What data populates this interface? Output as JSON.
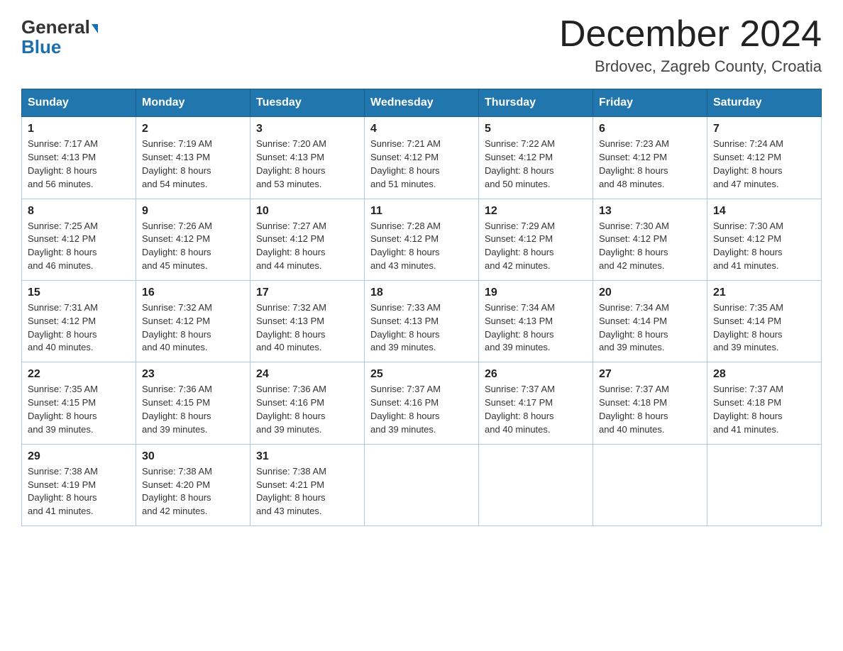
{
  "header": {
    "logo_general": "General",
    "logo_blue": "Blue",
    "month_title": "December 2024",
    "location": "Brdovec, Zagreb County, Croatia"
  },
  "weekdays": [
    "Sunday",
    "Monday",
    "Tuesday",
    "Wednesday",
    "Thursday",
    "Friday",
    "Saturday"
  ],
  "weeks": [
    [
      {
        "day": "1",
        "sunrise": "7:17 AM",
        "sunset": "4:13 PM",
        "daylight": "8 hours and 56 minutes."
      },
      {
        "day": "2",
        "sunrise": "7:19 AM",
        "sunset": "4:13 PM",
        "daylight": "8 hours and 54 minutes."
      },
      {
        "day": "3",
        "sunrise": "7:20 AM",
        "sunset": "4:13 PM",
        "daylight": "8 hours and 53 minutes."
      },
      {
        "day": "4",
        "sunrise": "7:21 AM",
        "sunset": "4:12 PM",
        "daylight": "8 hours and 51 minutes."
      },
      {
        "day": "5",
        "sunrise": "7:22 AM",
        "sunset": "4:12 PM",
        "daylight": "8 hours and 50 minutes."
      },
      {
        "day": "6",
        "sunrise": "7:23 AM",
        "sunset": "4:12 PM",
        "daylight": "8 hours and 48 minutes."
      },
      {
        "day": "7",
        "sunrise": "7:24 AM",
        "sunset": "4:12 PM",
        "daylight": "8 hours and 47 minutes."
      }
    ],
    [
      {
        "day": "8",
        "sunrise": "7:25 AM",
        "sunset": "4:12 PM",
        "daylight": "8 hours and 46 minutes."
      },
      {
        "day": "9",
        "sunrise": "7:26 AM",
        "sunset": "4:12 PM",
        "daylight": "8 hours and 45 minutes."
      },
      {
        "day": "10",
        "sunrise": "7:27 AM",
        "sunset": "4:12 PM",
        "daylight": "8 hours and 44 minutes."
      },
      {
        "day": "11",
        "sunrise": "7:28 AM",
        "sunset": "4:12 PM",
        "daylight": "8 hours and 43 minutes."
      },
      {
        "day": "12",
        "sunrise": "7:29 AM",
        "sunset": "4:12 PM",
        "daylight": "8 hours and 42 minutes."
      },
      {
        "day": "13",
        "sunrise": "7:30 AM",
        "sunset": "4:12 PM",
        "daylight": "8 hours and 42 minutes."
      },
      {
        "day": "14",
        "sunrise": "7:30 AM",
        "sunset": "4:12 PM",
        "daylight": "8 hours and 41 minutes."
      }
    ],
    [
      {
        "day": "15",
        "sunrise": "7:31 AM",
        "sunset": "4:12 PM",
        "daylight": "8 hours and 40 minutes."
      },
      {
        "day": "16",
        "sunrise": "7:32 AM",
        "sunset": "4:12 PM",
        "daylight": "8 hours and 40 minutes."
      },
      {
        "day": "17",
        "sunrise": "7:32 AM",
        "sunset": "4:13 PM",
        "daylight": "8 hours and 40 minutes."
      },
      {
        "day": "18",
        "sunrise": "7:33 AM",
        "sunset": "4:13 PM",
        "daylight": "8 hours and 39 minutes."
      },
      {
        "day": "19",
        "sunrise": "7:34 AM",
        "sunset": "4:13 PM",
        "daylight": "8 hours and 39 minutes."
      },
      {
        "day": "20",
        "sunrise": "7:34 AM",
        "sunset": "4:14 PM",
        "daylight": "8 hours and 39 minutes."
      },
      {
        "day": "21",
        "sunrise": "7:35 AM",
        "sunset": "4:14 PM",
        "daylight": "8 hours and 39 minutes."
      }
    ],
    [
      {
        "day": "22",
        "sunrise": "7:35 AM",
        "sunset": "4:15 PM",
        "daylight": "8 hours and 39 minutes."
      },
      {
        "day": "23",
        "sunrise": "7:36 AM",
        "sunset": "4:15 PM",
        "daylight": "8 hours and 39 minutes."
      },
      {
        "day": "24",
        "sunrise": "7:36 AM",
        "sunset": "4:16 PM",
        "daylight": "8 hours and 39 minutes."
      },
      {
        "day": "25",
        "sunrise": "7:37 AM",
        "sunset": "4:16 PM",
        "daylight": "8 hours and 39 minutes."
      },
      {
        "day": "26",
        "sunrise": "7:37 AM",
        "sunset": "4:17 PM",
        "daylight": "8 hours and 40 minutes."
      },
      {
        "day": "27",
        "sunrise": "7:37 AM",
        "sunset": "4:18 PM",
        "daylight": "8 hours and 40 minutes."
      },
      {
        "day": "28",
        "sunrise": "7:37 AM",
        "sunset": "4:18 PM",
        "daylight": "8 hours and 41 minutes."
      }
    ],
    [
      {
        "day": "29",
        "sunrise": "7:38 AM",
        "sunset": "4:19 PM",
        "daylight": "8 hours and 41 minutes."
      },
      {
        "day": "30",
        "sunrise": "7:38 AM",
        "sunset": "4:20 PM",
        "daylight": "8 hours and 42 minutes."
      },
      {
        "day": "31",
        "sunrise": "7:38 AM",
        "sunset": "4:21 PM",
        "daylight": "8 hours and 43 minutes."
      },
      null,
      null,
      null,
      null
    ]
  ],
  "labels": {
    "sunrise": "Sunrise:",
    "sunset": "Sunset:",
    "daylight": "Daylight:"
  }
}
